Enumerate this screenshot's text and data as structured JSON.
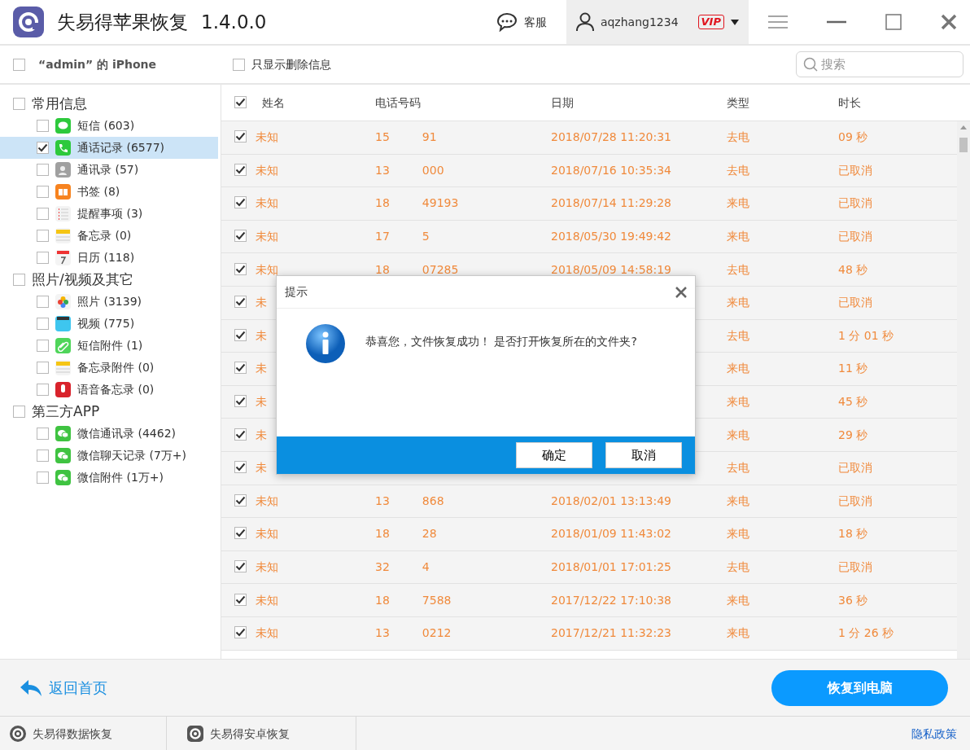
{
  "app": {
    "title": "失易得苹果恢复",
    "version": "1.4.0.0"
  },
  "header": {
    "support": "客服",
    "username": "aqzhang1234",
    "vip": "VIP"
  },
  "toolbar": {
    "device": {
      "label": "“admin” 的 iPhone",
      "checked": false
    },
    "only_deleted": {
      "label": "只显示删除信息",
      "checked": false
    },
    "search": {
      "placeholder": "搜索"
    }
  },
  "sidebar": [
    {
      "label": "常用信息",
      "checked": false,
      "children": [
        {
          "label": "短信 (603)",
          "kind": "messages",
          "checked": false,
          "selected": false
        },
        {
          "label": "通话记录 (6577)",
          "kind": "phone",
          "checked": true,
          "selected": true
        },
        {
          "label": "通讯录 (57)",
          "kind": "contacts",
          "checked": false,
          "selected": false
        },
        {
          "label": "书签 (8)",
          "kind": "bookmarks",
          "checked": false,
          "selected": false
        },
        {
          "label": "提醒事项 (3)",
          "kind": "reminders",
          "checked": false,
          "selected": false
        },
        {
          "label": "备忘录 (0)",
          "kind": "notes",
          "checked": false,
          "selected": false
        },
        {
          "label": "日历 (118)",
          "kind": "calendar",
          "checked": false,
          "selected": false
        }
      ]
    },
    {
      "label": "照片/视频及其它",
      "checked": false,
      "children": [
        {
          "label": "照片 (3139)",
          "kind": "photos",
          "checked": false,
          "selected": false
        },
        {
          "label": "视频 (775)",
          "kind": "videos",
          "checked": false,
          "selected": false
        },
        {
          "label": "短信附件 (1)",
          "kind": "attachment",
          "checked": false,
          "selected": false
        },
        {
          "label": "备忘录附件 (0)",
          "kind": "notes",
          "checked": false,
          "selected": false
        },
        {
          "label": "语音备忘录 (0)",
          "kind": "voice",
          "checked": false,
          "selected": false
        }
      ]
    },
    {
      "label": "第三方APP",
      "checked": false,
      "children": [
        {
          "label": "微信通讯录 (4462)",
          "kind": "wechat",
          "checked": false,
          "selected": false
        },
        {
          "label": "微信聊天记录 (7万+)",
          "kind": "wechat",
          "checked": false,
          "selected": false
        },
        {
          "label": "微信附件 (1万+)",
          "kind": "wechat",
          "checked": false,
          "selected": false
        }
      ]
    }
  ],
  "table": {
    "all_checked": true,
    "columns": [
      "姓名",
      "电话号码",
      "日期",
      "类型",
      "时长"
    ],
    "rows": [
      {
        "checked": true,
        "name": "未知",
        "phone_head": "15",
        "phone_tail": "91",
        "date": "2018/07/28 11:20:31",
        "type": "去电",
        "duration": "09 秒"
      },
      {
        "checked": true,
        "name": "未知",
        "phone_head": "13",
        "phone_tail": "000",
        "date": "2018/07/16 10:35:34",
        "type": "去电",
        "duration": "已取消"
      },
      {
        "checked": true,
        "name": "未知",
        "phone_head": "18",
        "phone_tail": "49193",
        "date": "2018/07/14 11:29:28",
        "type": "来电",
        "duration": "已取消"
      },
      {
        "checked": true,
        "name": "未知",
        "phone_head": "17",
        "phone_tail": "5",
        "date": "2018/05/30 19:49:42",
        "type": "来电",
        "duration": "已取消"
      },
      {
        "checked": true,
        "name": "未知",
        "phone_head": "18",
        "phone_tail": "07285",
        "date": "2018/05/09 14:58:19",
        "type": "去电",
        "duration": "48 秒"
      },
      {
        "checked": true,
        "name": "未",
        "type": "来电",
        "duration": "已取消"
      },
      {
        "checked": true,
        "name": "未",
        "type": "去电",
        "duration": "1 分 01 秒"
      },
      {
        "checked": true,
        "name": "未",
        "type": "来电",
        "duration": "11 秒"
      },
      {
        "checked": true,
        "name": "未",
        "type": "来电",
        "duration": "45 秒"
      },
      {
        "checked": true,
        "name": "未",
        "type": "来电",
        "duration": "29 秒"
      },
      {
        "checked": true,
        "name": "未",
        "type": "去电",
        "duration": "已取消"
      },
      {
        "checked": true,
        "name": "未知",
        "phone_head": "13",
        "phone_tail": "868",
        "date": "2018/02/01 13:13:49",
        "type": "来电",
        "duration": "已取消"
      },
      {
        "checked": true,
        "name": "未知",
        "phone_head": "18",
        "phone_tail": "28",
        "date": "2018/01/09 11:43:02",
        "type": "来电",
        "duration": "18 秒"
      },
      {
        "checked": true,
        "name": "未知",
        "phone_head": "32",
        "phone_tail": "4",
        "date": "2018/01/01 17:01:25",
        "type": "去电",
        "duration": "已取消"
      },
      {
        "checked": true,
        "name": "未知",
        "phone_head": "18",
        "phone_tail": "7588",
        "date": "2017/12/22 17:10:38",
        "type": "来电",
        "duration": "36 秒"
      },
      {
        "checked": true,
        "name": "未知",
        "phone_head": "13",
        "phone_tail": "0212",
        "date": "2017/12/21 11:32:23",
        "type": "来电",
        "duration": "1 分 26 秒"
      }
    ]
  },
  "dialog": {
    "title": "提示",
    "message": "恭喜您，文件恢复成功！ 是否打开恢复所在的文件夹?",
    "buttons": [
      "确定",
      "取消"
    ]
  },
  "footer": {
    "back": "返回首页",
    "recover": "恢复到电脑"
  },
  "status_bar": {
    "links": [
      "失易得数据恢复",
      "失易得安卓恢复"
    ],
    "privacy": "隐私政策"
  }
}
